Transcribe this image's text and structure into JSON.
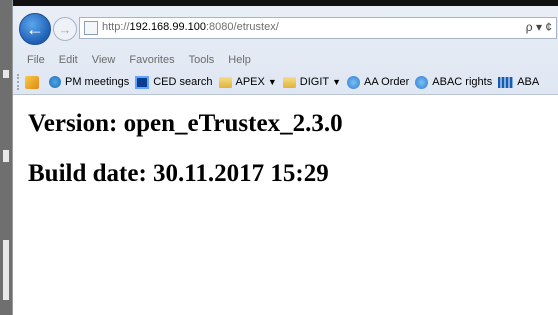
{
  "browser": {
    "address_bar": {
      "scheme": "http://",
      "host": "192.168.99.100",
      "rest": ":8080/etrustex/",
      "tools": "ρ ▾ ¢"
    },
    "nav": {
      "back_icon": "arrow-left-icon",
      "forward_icon": "arrow-right-icon"
    },
    "menu": [
      "File",
      "Edit",
      "View",
      "Favorites",
      "Tools",
      "Help"
    ],
    "favorites": [
      {
        "label": "",
        "icon": "add-favorites-icon"
      },
      {
        "label": "PM meetings",
        "icon": "ie-page-icon"
      },
      {
        "label": "CED search",
        "icon": "ced-icon"
      },
      {
        "label": "APEX",
        "icon": "folder-icon",
        "dropdown": true
      },
      {
        "label": "DIGIT",
        "icon": "folder-icon",
        "dropdown": true
      },
      {
        "label": "AA Order",
        "icon": "ie-page-icon"
      },
      {
        "label": "ABAC rights",
        "icon": "ie-page-icon"
      },
      {
        "label": "ABA",
        "icon": "abac-icon"
      }
    ]
  },
  "page": {
    "version_text": "Version: open_eTrustex_2.3.0",
    "build_text": "Build date: 30.11.2017 15:29"
  },
  "colors": {
    "chrome_bg": "#e3eaf5",
    "back_button": "#2a6cc3",
    "page_bg": "#ffffff",
    "left_strip": "#6f6f6f"
  }
}
